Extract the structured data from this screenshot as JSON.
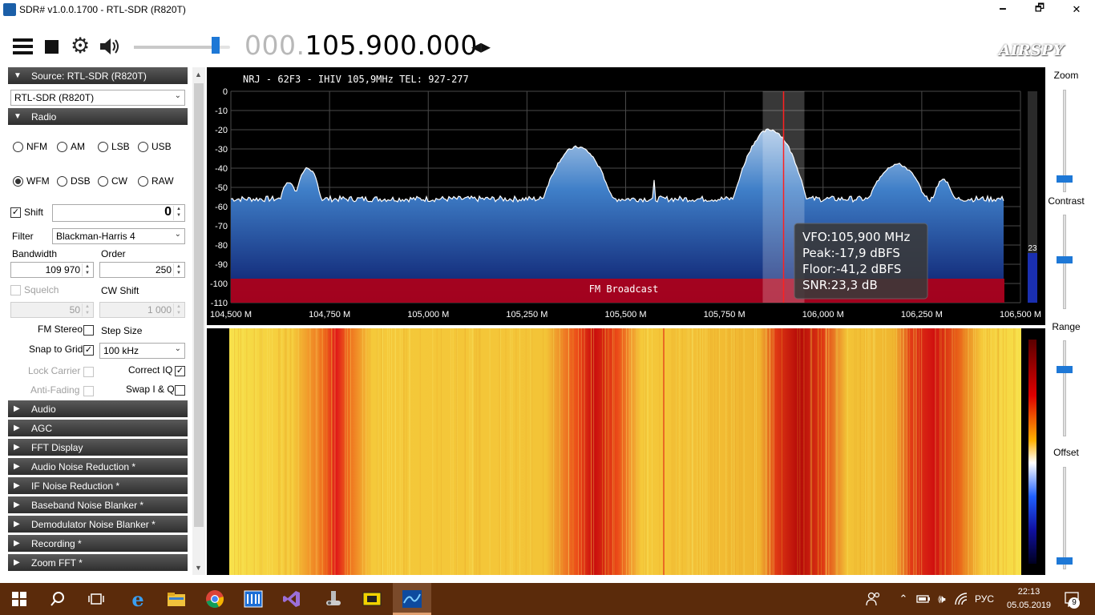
{
  "window": {
    "title": "SDR# v1.0.0.1700 - RTL-SDR (R820T)",
    "minimize": "🗕",
    "maximize": "🗗",
    "close": "✕"
  },
  "toolbar": {
    "menu_icon": "menu-icon",
    "stop_icon": "stop-icon",
    "settings_icon": "gear-icon",
    "audio_icon": "speaker-icon",
    "volume_level": 0.85,
    "freq_prefix": "000.",
    "freq_main": "105.900.000",
    "tune_arrows": "◂▸",
    "logo": "AIRSPY"
  },
  "source": {
    "header": "Source: RTL-SDR (R820T)",
    "device": "RTL-SDR (R820T)"
  },
  "radio": {
    "header": "Radio",
    "modes_row1": [
      "NFM",
      "AM",
      "LSB",
      "USB"
    ],
    "modes_row2": [
      "WFM",
      "DSB",
      "CW",
      "RAW"
    ],
    "selected_mode": "WFM",
    "shift_label": "Shift",
    "shift_value": "0",
    "filter_label": "Filter",
    "filter_value": "Blackman-Harris 4",
    "bandwidth_label": "Bandwidth",
    "bandwidth_value": "109 970",
    "order_label": "Order",
    "order_value": "250",
    "squelch_label": "Squelch",
    "squelch_value": "50",
    "cwshift_label": "CW Shift",
    "cwshift_value": "1 000",
    "fm_stereo": "FM Stereo",
    "step_size": "Step Size",
    "snap_to_grid": "Snap to Grid",
    "step_value": "100 kHz",
    "lock_carrier": "Lock Carrier",
    "correct_iq": "Correct IQ",
    "anti_fading": "Anti-Fading",
    "swap_iq": "Swap I & Q"
  },
  "panels": [
    "Audio",
    "AGC",
    "FFT Display",
    "Audio Noise Reduction *",
    "IF Noise Reduction *",
    "Baseband Noise Blanker *",
    "Demodulator Noise Blanker *",
    "Recording *",
    "Zoom FFT *"
  ],
  "spectrum": {
    "rds_text": "NRJ    - 62F3 -    IHIV 105,9MHz TEL: 927-277",
    "y_ticks": [
      "0",
      "-10",
      "-20",
      "-30",
      "-40",
      "-50",
      "-60",
      "-70",
      "-80",
      "-90",
      "-100",
      "-110"
    ],
    "x_ticks": [
      "104,500 M",
      "104,750 M",
      "105,000 M",
      "105,250 M",
      "105,500 M",
      "105,750 M",
      "106,000 M",
      "106,250 M",
      "106,500 M"
    ],
    "band_label": "FM Broadcast",
    "vfo": "VFO:105,900 MHz",
    "peak": "Peak:-17,9 dBFS",
    "floor": "Floor:-41,2 dBFS",
    "snr": "SNR:23,3 dB",
    "snr_meter_value": "23",
    "colors": {
      "fill_top": "#a9c6e6",
      "fill_bottom": "#0a1a6a",
      "band": "#b00018",
      "vfo_line": "#ff2020"
    }
  },
  "sliders": {
    "zoom": "Zoom",
    "contrast": "Contrast",
    "range": "Range",
    "offset": "Offset"
  },
  "taskbar": {
    "lang": "РУС",
    "time": "22:13",
    "date": "05.05.2019",
    "notifications": "9"
  }
}
